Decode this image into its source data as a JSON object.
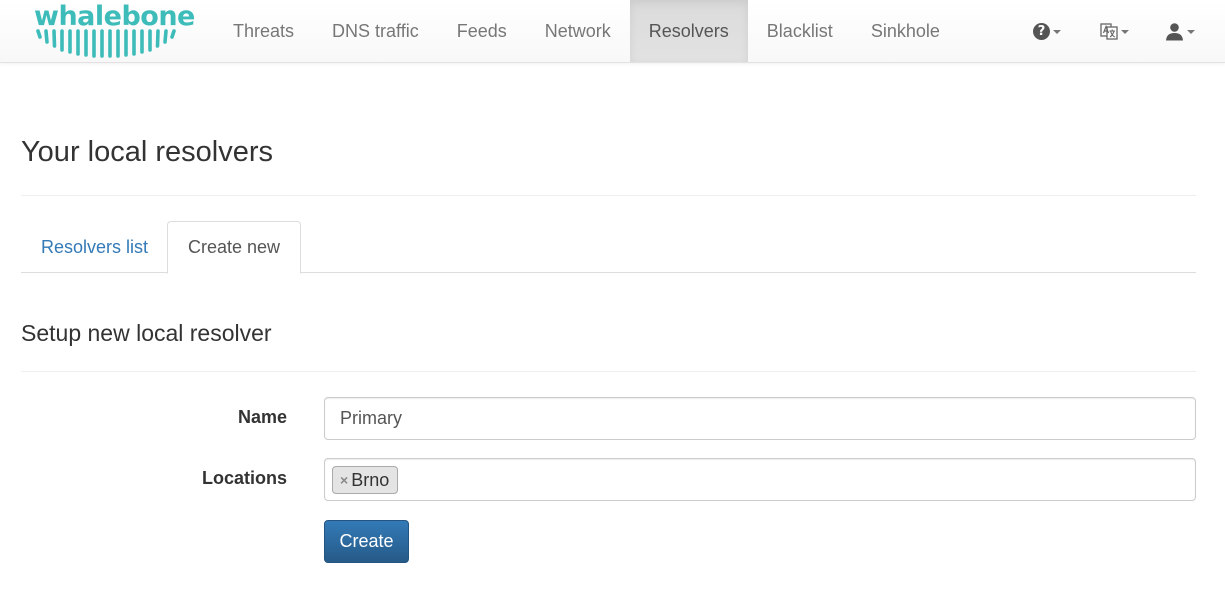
{
  "brand": {
    "name": "whalebone",
    "color": "#3dbcb9"
  },
  "nav": {
    "items": [
      {
        "label": "Threats"
      },
      {
        "label": "DNS traffic"
      },
      {
        "label": "Feeds"
      },
      {
        "label": "Network"
      },
      {
        "label": "Resolvers",
        "active": true
      },
      {
        "label": "Blacklist"
      },
      {
        "label": "Sinkhole"
      }
    ],
    "help_glyph": "?",
    "icons": [
      "question-circle-icon",
      "language-icon",
      "user-icon"
    ]
  },
  "page": {
    "title": "Your local resolvers"
  },
  "tabs": [
    {
      "label": "Resolvers list",
      "active": false
    },
    {
      "label": "Create new",
      "active": true
    }
  ],
  "form": {
    "section_title": "Setup new local resolver",
    "name_label": "Name",
    "name_value": "Primary",
    "locations_label": "Locations",
    "locations": [
      {
        "label": "Brno"
      }
    ],
    "tag_remove_glyph": "×",
    "submit_label": "Create"
  },
  "colors": {
    "link": "#337ab7",
    "primary_button": "#337ab7",
    "active_nav_bg": "#e2e2e2"
  }
}
